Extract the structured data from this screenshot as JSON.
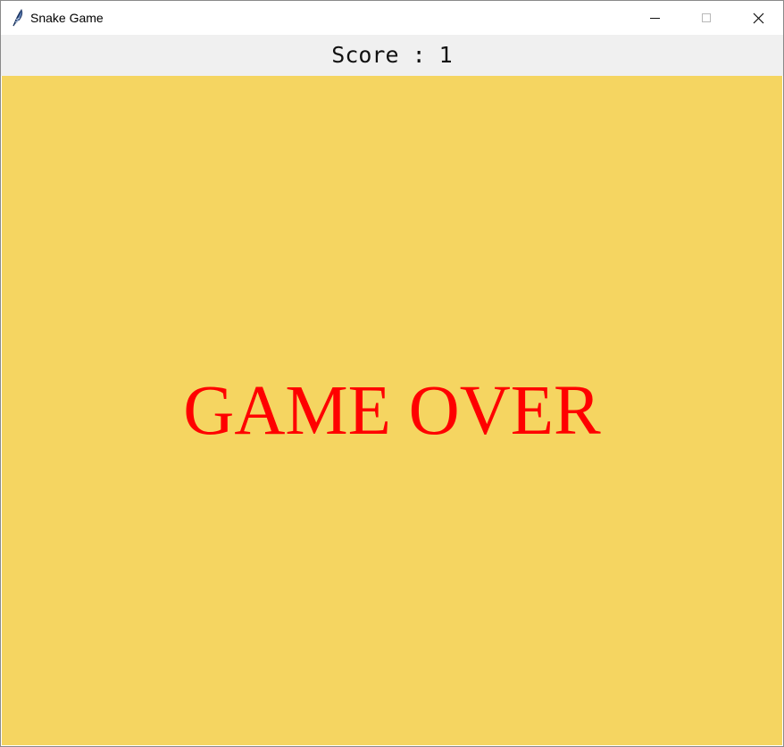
{
  "window": {
    "title": "Snake Game",
    "icon": "feather-icon",
    "controls": {
      "minimize_icon": "minimize-icon",
      "maximize_icon": "maximize-icon",
      "close_icon": "close-icon"
    }
  },
  "score": {
    "text": "Score : 1"
  },
  "game": {
    "message": "GAME OVER",
    "message_color": "#ff0000",
    "background_color": "#f5d561"
  }
}
